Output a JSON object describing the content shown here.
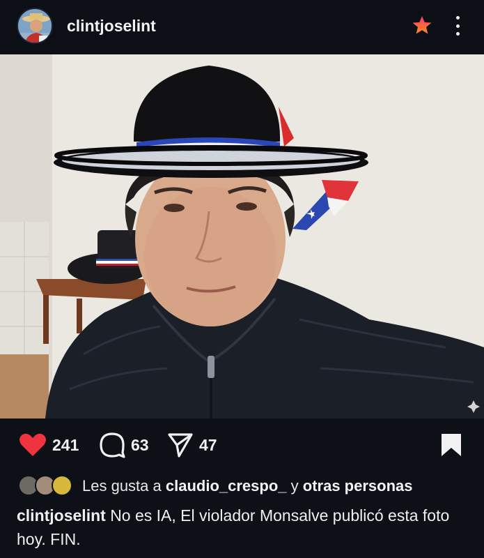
{
  "post": {
    "username": "clintjoselint",
    "likes_count": "241",
    "comments_count": "63",
    "shares_count": "47",
    "liked_by_prefix": "Les gusta a",
    "liked_by_user": "claudio_crespo_",
    "liked_by_middle": "y",
    "liked_by_suffix": "otras personas",
    "caption_text": "No es IA, El violador Monsalve publicó esta foto hoy. FIN."
  },
  "icons": {
    "favorite": "star-icon",
    "more": "more-vertical-icon",
    "like": "heart-icon",
    "comment": "comment-bubble-icon",
    "share": "paper-plane-icon",
    "save": "bookmark-icon"
  },
  "colors": {
    "background": "#0d1117",
    "heart": "#ef3340",
    "star_top": "#ff3b6b",
    "star_bottom": "#ff8a1f",
    "text": "#f0f0f0"
  }
}
